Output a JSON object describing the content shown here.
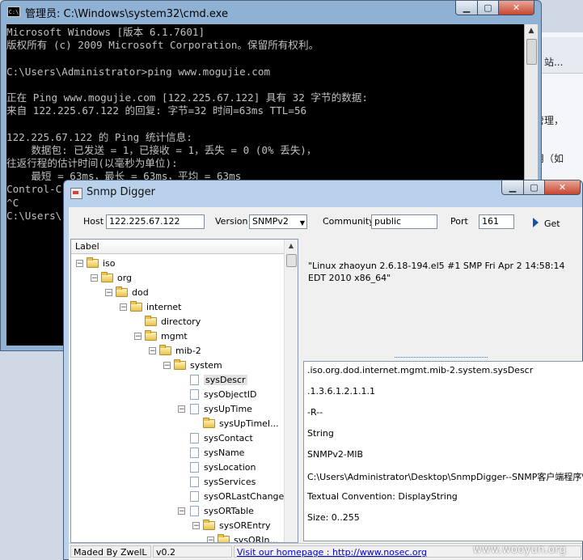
{
  "background": {
    "lines": [
      "器 - 站...",
      "器管理，",
      "应用（如"
    ]
  },
  "cmd": {
    "title": "管理员: C:\\Windows\\system32\\cmd.exe",
    "lines": [
      "Microsoft Windows [版本 6.1.7601]",
      "版权所有 (c) 2009 Microsoft Corporation。保留所有权利。",
      "",
      "C:\\Users\\Administrator>ping www.mogujie.com",
      "",
      "正在 Ping www.mogujie.com [122.225.67.122] 具有 32 字节的数据:",
      "来自 122.225.67.122 的回复: 字节=32 时间=63ms TTL=56",
      "",
      "122.225.67.122 的 Ping 统计信息:",
      "    数据包: 已发送 = 1，已接收 = 1，丢失 = 0 (0% 丢失)，",
      "往返行程的估计时间(以毫秒为单位):",
      "    最短 = 63ms，最长 = 63ms，平均 = 63ms",
      "Control-C",
      "^C",
      "C:\\Users\\"
    ]
  },
  "snmp": {
    "title": "Snmp Digger",
    "host_label": "Host",
    "host_value": "122.225.67.122",
    "version_label": "Version",
    "version_value": "SNMPv2",
    "community_label": "Community",
    "community_value": "public",
    "port_label": "Port",
    "port_value": "161",
    "get_label": "Get",
    "tree_header": "Label",
    "tree": [
      {
        "label": "iso",
        "level": 0,
        "type": "folder",
        "expanded": true
      },
      {
        "label": "org",
        "level": 1,
        "type": "folder",
        "expanded": true
      },
      {
        "label": "dod",
        "level": 2,
        "type": "folder",
        "expanded": true
      },
      {
        "label": "internet",
        "level": 3,
        "type": "folder",
        "expanded": true
      },
      {
        "label": "directory",
        "level": 4,
        "type": "folder",
        "expanded": null
      },
      {
        "label": "mgmt",
        "level": 4,
        "type": "folder",
        "expanded": true
      },
      {
        "label": "mib-2",
        "level": 5,
        "type": "folder",
        "expanded": true
      },
      {
        "label": "system",
        "level": 6,
        "type": "folder",
        "expanded": true
      },
      {
        "label": "sysDescr",
        "level": 7,
        "type": "doc",
        "expanded": null,
        "selected": true
      },
      {
        "label": "sysObjectID",
        "level": 7,
        "type": "doc",
        "expanded": null
      },
      {
        "label": "sysUpTime",
        "level": 7,
        "type": "doc",
        "expanded": true
      },
      {
        "label": "sysUpTimeI...",
        "level": 8,
        "type": "folder",
        "expanded": null
      },
      {
        "label": "sysContact",
        "level": 7,
        "type": "doc",
        "expanded": null
      },
      {
        "label": "sysName",
        "level": 7,
        "type": "doc",
        "expanded": null
      },
      {
        "label": "sysLocation",
        "level": 7,
        "type": "doc",
        "expanded": null
      },
      {
        "label": "sysServices",
        "level": 7,
        "type": "doc",
        "expanded": null
      },
      {
        "label": "sysORLastChange",
        "level": 7,
        "type": "doc",
        "expanded": null
      },
      {
        "label": "sysORTable",
        "level": 7,
        "type": "doc",
        "expanded": true
      },
      {
        "label": "sysOREntry",
        "level": 8,
        "type": "folder",
        "expanded": true
      },
      {
        "label": "sysORIn...",
        "level": 9,
        "type": "folder",
        "expanded": true
      }
    ],
    "value_text": "\"Linux zhaoyun 2.6.18-194.el5 #1 SMP Fri Apr 2 14:58:14 EDT 2010 x86_64\"",
    "details": [
      ".iso.org.dod.internet.mgmt.mib-2.system.sysDescr",
      ".1.3.6.1.2.1.1.1",
      "-R--",
      "String",
      "SNMPv2-MIB",
      "C:\\Users\\Administrator\\Desktop\\SnmpDigger--SNMP客户端程序\\r",
      "Textual Convention: DisplayString",
      "Size: 0..255"
    ],
    "status": {
      "author": "Maded By ZwelL",
      "version": "v0.2",
      "homepage": "Visit our homepage :  http://www.nosec.org"
    }
  },
  "watermark": "www.wooyun.org"
}
